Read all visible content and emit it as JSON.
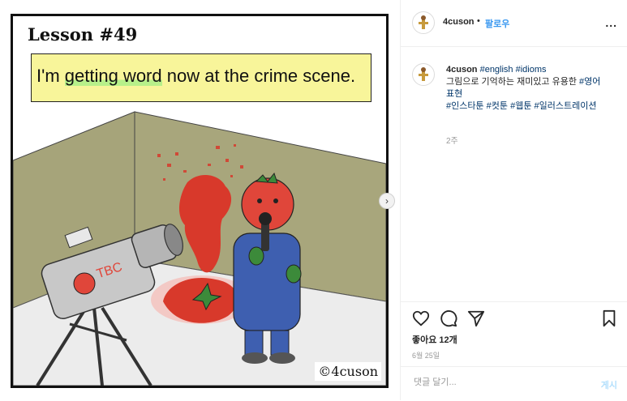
{
  "comic": {
    "lesson": "Lesson #49",
    "caption_before": "I'm ",
    "caption_highlight": "getting word",
    "caption_after": " now at the crime scene.",
    "camera_label": "TBC",
    "signature": "©4cuson"
  },
  "header": {
    "username": "4cuson",
    "separator": "•",
    "follow_label": "팔로우",
    "more_label": "..."
  },
  "caption": {
    "username": "4cuson",
    "tag1": "#english",
    "tag2": "#idioms",
    "line_text": "그림으로 기억하는 재미있고 유용한",
    "tag3": "#영어표현",
    "tag4": "#인스타툰",
    "tag5": "#컷툰",
    "tag6": "#웹툰",
    "tag7": "#일러스트레이션",
    "time_ago": "2주"
  },
  "actions": {
    "icons": [
      "heart-icon",
      "comment-icon",
      "share-icon",
      "bookmark-icon"
    ]
  },
  "likes": "좋아요 12개",
  "date": "6월 25일",
  "comment_box": {
    "placeholder": "댓글 달기...",
    "post_label": "게시"
  },
  "colors": {
    "follow": "#3897f0",
    "hashtag": "#003569",
    "caption_bg": "#f8f59a",
    "highlight": "#b7f08a",
    "blood": "#d8392b"
  }
}
